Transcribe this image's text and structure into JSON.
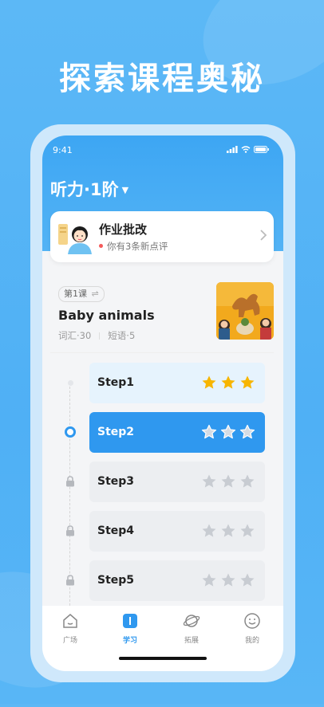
{
  "headline": "探索课程奥秘",
  "status": {
    "time": "9:41"
  },
  "level": {
    "label": "听力·1阶"
  },
  "homework": {
    "title": "作业批改",
    "subtitle": "你有3条新点评"
  },
  "lesson": {
    "tag": "第1课",
    "tag_icon": "swap-icon",
    "title": "Baby animals",
    "vocab": "词汇·30",
    "phrases": "短语·5"
  },
  "steps": [
    {
      "label": "Step1",
      "state": "done",
      "stars_earned": 3,
      "stars_total": 3
    },
    {
      "label": "Step2",
      "state": "active",
      "stars_earned": 0,
      "stars_total": 3
    },
    {
      "label": "Step3",
      "state": "locked",
      "stars_earned": 0,
      "stars_total": 3
    },
    {
      "label": "Step4",
      "state": "locked",
      "stars_earned": 0,
      "stars_total": 3
    },
    {
      "label": "Step5",
      "state": "locked",
      "stars_earned": 0,
      "stars_total": 3
    }
  ],
  "tabs": [
    {
      "label": "广场",
      "icon": "home-icon"
    },
    {
      "label": "学习",
      "icon": "book-icon",
      "active": true
    },
    {
      "label": "拓展",
      "icon": "planet-icon"
    },
    {
      "label": "我的",
      "icon": "smile-icon"
    }
  ],
  "colors": {
    "accent": "#2f98ef",
    "star": "#f7b500",
    "background": "#4fb0f5"
  }
}
